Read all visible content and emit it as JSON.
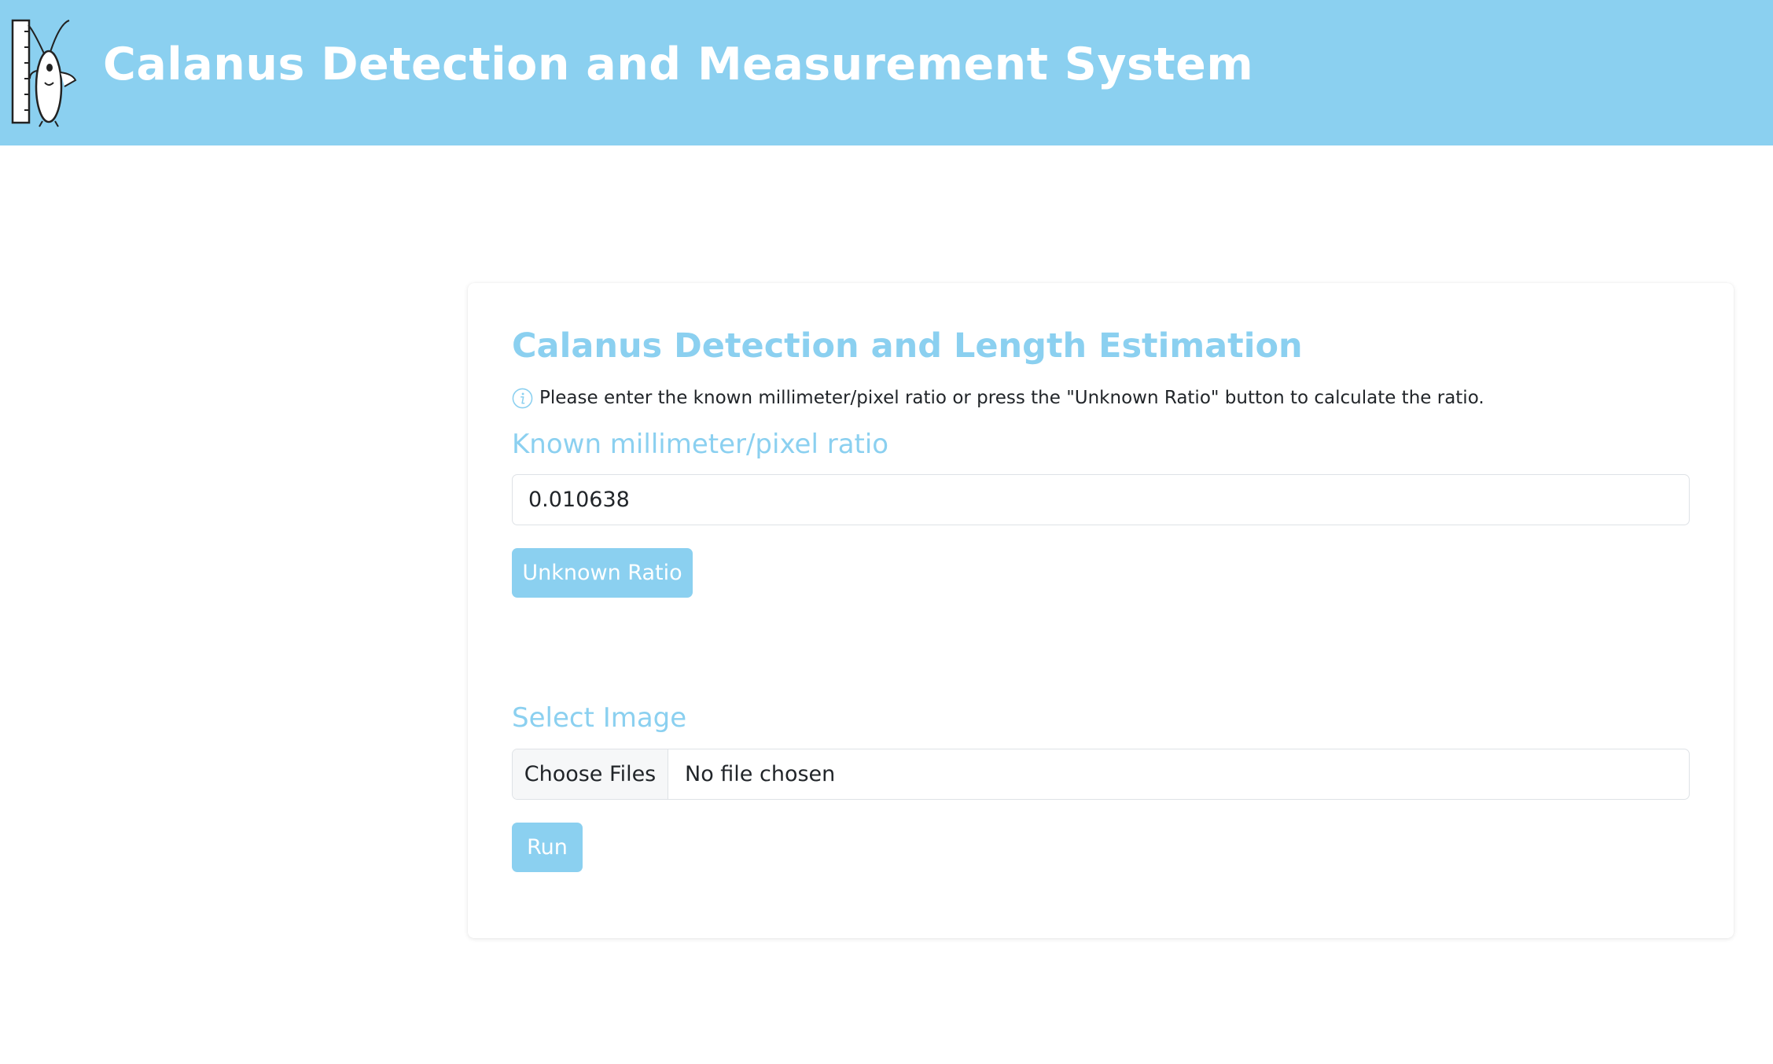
{
  "header": {
    "title": "Calanus Detection and Measurement System",
    "logo_icon": "calanus-ruler-logo-icon",
    "background_color": "#8bd0f0"
  },
  "card": {
    "title": "Calanus Detection and Length Estimation",
    "info_icon": "info-circle-icon",
    "info_text": "Please enter the known millimeter/pixel ratio or press the \"Unknown Ratio\" button to calculate the ratio.",
    "ratio": {
      "label": "Known millimeter/pixel ratio",
      "value": "0.010638"
    },
    "unknown_ratio_button": "Unknown Ratio",
    "image": {
      "label": "Select Image",
      "choose_button": "Choose Files",
      "status": "No file chosen"
    },
    "run_button": "Run",
    "accent_color": "#8bd0f0"
  }
}
